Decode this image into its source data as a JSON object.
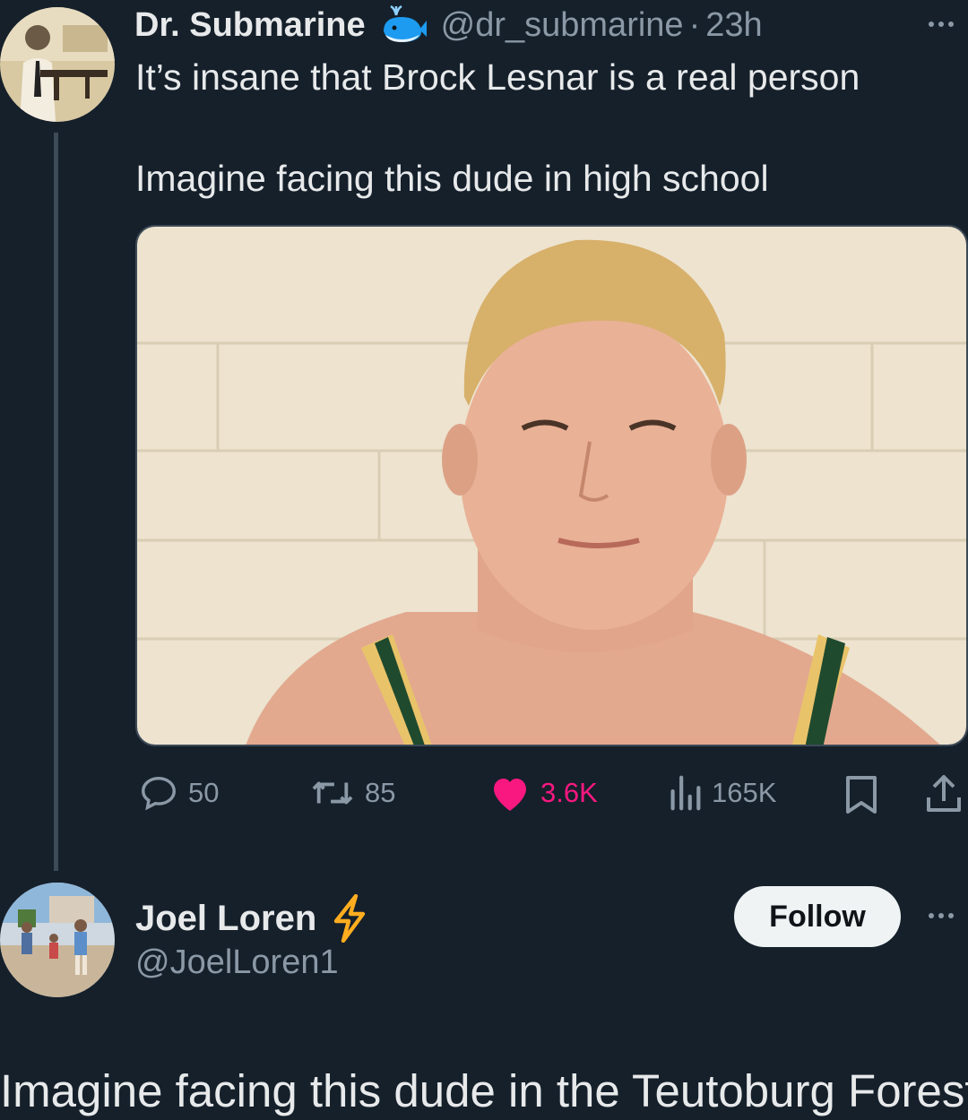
{
  "tweet": {
    "display_name": "Dr. Submarine",
    "handle": "@dr_submarine",
    "separator": "·",
    "time": "23h",
    "text_line1": "It’s insane that Brock Lesnar is a real person",
    "text_line2": "Imagine facing this dude in high school",
    "actions": {
      "replies": "50",
      "retweets": "85",
      "likes": "3.6K",
      "views": "165K"
    }
  },
  "reply_user": {
    "display_name": "Joel Loren",
    "handle": "@JoelLoren1",
    "follow_label": "Follow"
  },
  "caption": "Imagine facing this dude in the Teutoburg Forest.",
  "colors": {
    "background": "#15202b",
    "like_pink": "#f91880",
    "muted": "#8b98a5",
    "badge_bolt": "#ffad1f",
    "whale_blue": "#1d9bf0"
  },
  "icons": [
    "whale-emoji-icon",
    "more-icon",
    "reply-icon",
    "retweet-icon",
    "like-heart-icon",
    "views-icon",
    "bookmark-icon",
    "share-icon",
    "lightning-bolt-icon"
  ]
}
